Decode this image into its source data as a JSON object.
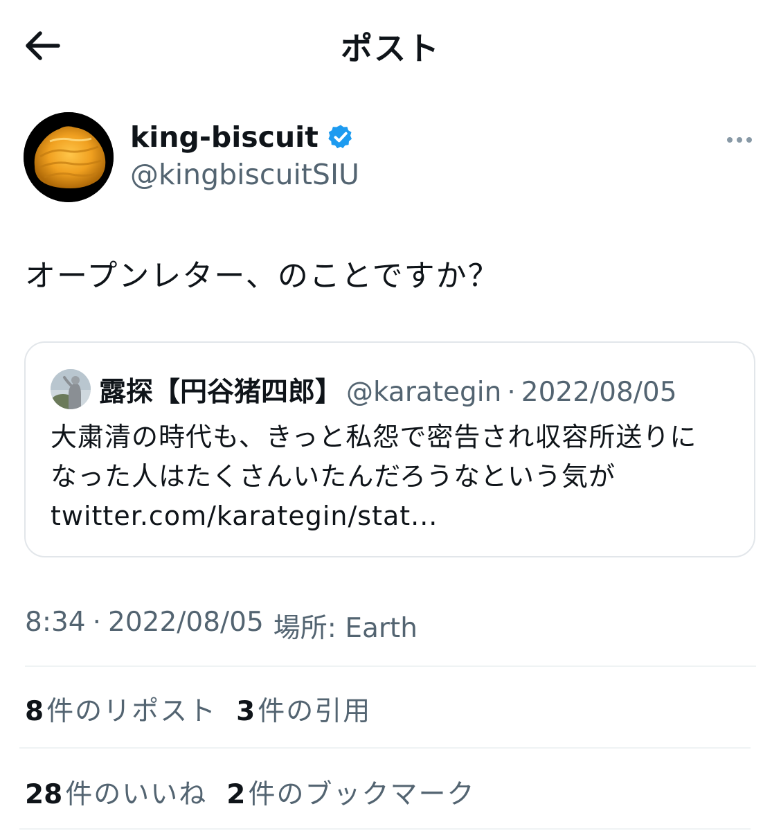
{
  "header": {
    "title": "ポスト",
    "back_icon": "arrow-left-icon"
  },
  "author": {
    "name": "king-biscuit",
    "handle": "@kingbiscuitSIU",
    "verified": true,
    "verified_color": "#1d9bf0"
  },
  "post": {
    "text": "オープンレター、のことですか？"
  },
  "quote": {
    "name": "露探【円谷猪四郎】",
    "handle": "@karategin",
    "separator": "·",
    "date": "2022/08/05",
    "lines": [
      "大粛清の時代も、きっと私怨で密告され収容所送りに",
      "なった人はたくさんいたんだろうなという気が",
      "twitter.com/karategin/stat..."
    ]
  },
  "meta": {
    "time": "8:34",
    "separator": "·",
    "date": "2022/08/05",
    "place": "場所: Earth"
  },
  "stats": {
    "reposts": {
      "num": "8",
      "label": "件のリポスト"
    },
    "quotes": {
      "num": "3",
      "label": "件の引用"
    },
    "likes": {
      "num": "28",
      "label": "件のいいね"
    },
    "bookmarks": {
      "num": "2",
      "label": "件のブックマーク"
    }
  },
  "colors": {
    "text": "#0f1419",
    "secondary": "#536471",
    "border": "#e2e6ea",
    "accent": "#1d9bf0"
  }
}
